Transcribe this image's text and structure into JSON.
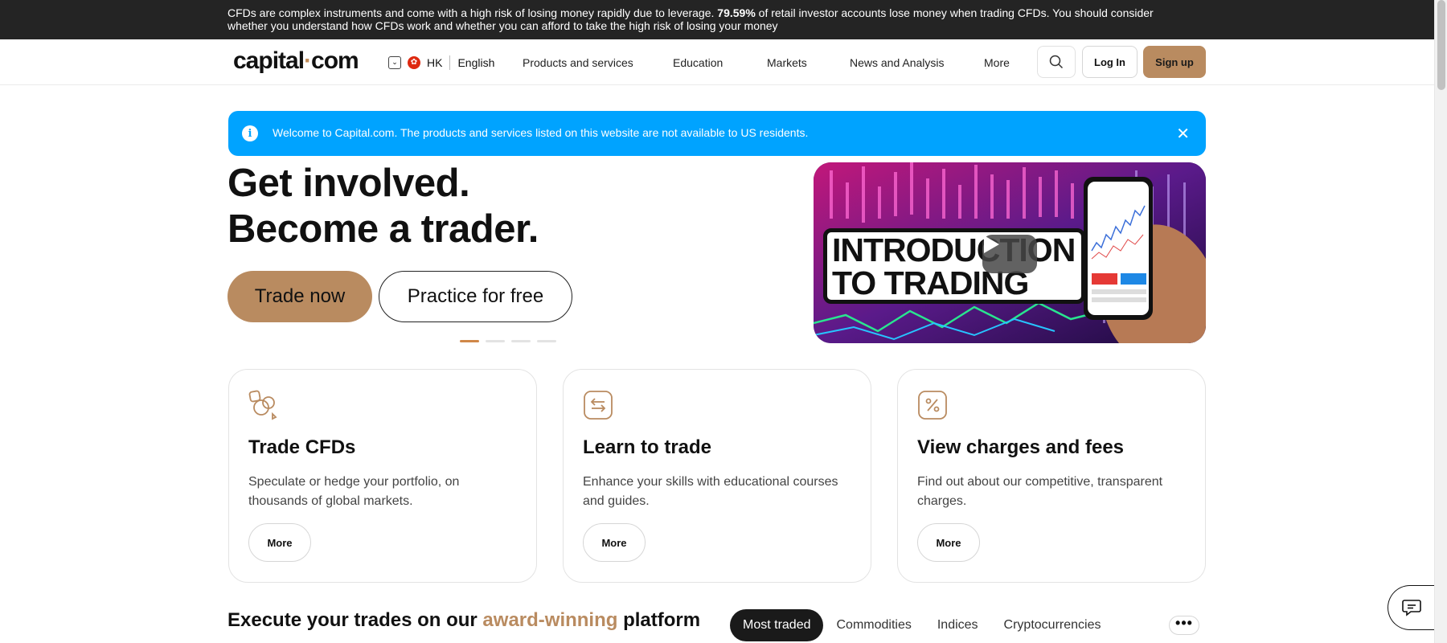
{
  "risk_warning": {
    "before": "CFDs are complex instruments and come with a high risk of losing money rapidly due to leverage. ",
    "percent": "79.59%",
    "after": " of retail investor accounts lose money when trading CFDs. You should consider whether you understand how CFDs work and whether you can afford to take the high risk of losing your money"
  },
  "header": {
    "logo_left": "capital",
    "logo_dot": "·",
    "logo_right": "com",
    "region": "HK",
    "language": "English",
    "nav": [
      "Products and services",
      "Education",
      "Markets",
      "News and Analysis",
      "More"
    ],
    "login_label": "Log In",
    "signup_label": "Sign up"
  },
  "notice": {
    "text": "Welcome to Capital.com. The products and services listed on this website are not available to US residents.",
    "close": "✕"
  },
  "hero": {
    "title_line1": "Get involved.",
    "title_line2": "Become a trader.",
    "primary_cta": "Trade now",
    "secondary_cta": "Practice for free",
    "video_caption_line1": "INTRODUCTION",
    "video_caption_line2": "TO TRADING"
  },
  "cards": [
    {
      "title": "Trade CFDs",
      "description": "Speculate or hedge your portfolio, on thousands of global markets.",
      "button": "More",
      "icon": "shapes-icon"
    },
    {
      "title": "Learn to trade",
      "description": "Enhance your skills with educational courses and guides.",
      "button": "More",
      "icon": "exchange-arrows-icon"
    },
    {
      "title": "View charges and fees",
      "description": "Find out about our competitive, transparent charges.",
      "button": "More",
      "icon": "percent-icon"
    }
  ],
  "platform": {
    "before": "Execute your trades on our ",
    "highlight": "award-winning",
    "after": " platform"
  },
  "market_tabs": [
    "Most traded",
    "Commodities",
    "Indices",
    "Cryptocurrencies"
  ],
  "colors": {
    "brand": "#b98b60",
    "notice": "#00a3ff",
    "risk_bar": "#242424"
  }
}
